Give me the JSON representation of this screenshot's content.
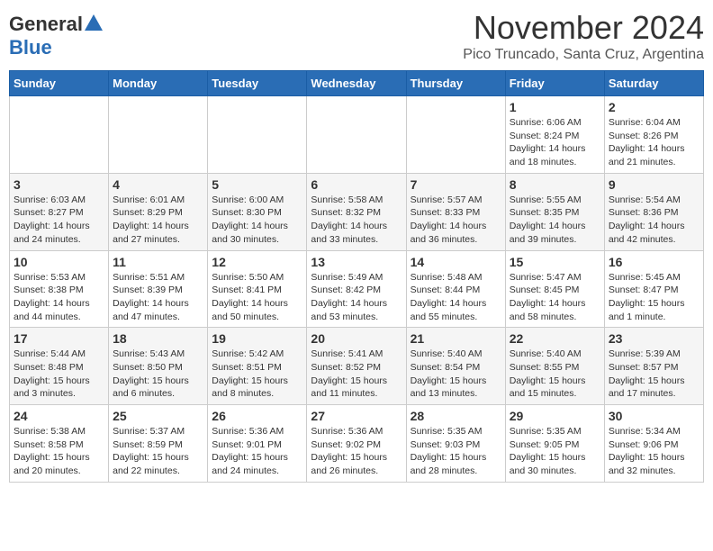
{
  "header": {
    "logo_general": "General",
    "logo_blue": "Blue",
    "month_title": "November 2024",
    "location": "Pico Truncado, Santa Cruz, Argentina"
  },
  "days_of_week": [
    "Sunday",
    "Monday",
    "Tuesday",
    "Wednesday",
    "Thursday",
    "Friday",
    "Saturday"
  ],
  "weeks": [
    [
      {
        "day": "",
        "info": ""
      },
      {
        "day": "",
        "info": ""
      },
      {
        "day": "",
        "info": ""
      },
      {
        "day": "",
        "info": ""
      },
      {
        "day": "",
        "info": ""
      },
      {
        "day": "1",
        "info": "Sunrise: 6:06 AM\nSunset: 8:24 PM\nDaylight: 14 hours and 18 minutes."
      },
      {
        "day": "2",
        "info": "Sunrise: 6:04 AM\nSunset: 8:26 PM\nDaylight: 14 hours and 21 minutes."
      }
    ],
    [
      {
        "day": "3",
        "info": "Sunrise: 6:03 AM\nSunset: 8:27 PM\nDaylight: 14 hours and 24 minutes."
      },
      {
        "day": "4",
        "info": "Sunrise: 6:01 AM\nSunset: 8:29 PM\nDaylight: 14 hours and 27 minutes."
      },
      {
        "day": "5",
        "info": "Sunrise: 6:00 AM\nSunset: 8:30 PM\nDaylight: 14 hours and 30 minutes."
      },
      {
        "day": "6",
        "info": "Sunrise: 5:58 AM\nSunset: 8:32 PM\nDaylight: 14 hours and 33 minutes."
      },
      {
        "day": "7",
        "info": "Sunrise: 5:57 AM\nSunset: 8:33 PM\nDaylight: 14 hours and 36 minutes."
      },
      {
        "day": "8",
        "info": "Sunrise: 5:55 AM\nSunset: 8:35 PM\nDaylight: 14 hours and 39 minutes."
      },
      {
        "day": "9",
        "info": "Sunrise: 5:54 AM\nSunset: 8:36 PM\nDaylight: 14 hours and 42 minutes."
      }
    ],
    [
      {
        "day": "10",
        "info": "Sunrise: 5:53 AM\nSunset: 8:38 PM\nDaylight: 14 hours and 44 minutes."
      },
      {
        "day": "11",
        "info": "Sunrise: 5:51 AM\nSunset: 8:39 PM\nDaylight: 14 hours and 47 minutes."
      },
      {
        "day": "12",
        "info": "Sunrise: 5:50 AM\nSunset: 8:41 PM\nDaylight: 14 hours and 50 minutes."
      },
      {
        "day": "13",
        "info": "Sunrise: 5:49 AM\nSunset: 8:42 PM\nDaylight: 14 hours and 53 minutes."
      },
      {
        "day": "14",
        "info": "Sunrise: 5:48 AM\nSunset: 8:44 PM\nDaylight: 14 hours and 55 minutes."
      },
      {
        "day": "15",
        "info": "Sunrise: 5:47 AM\nSunset: 8:45 PM\nDaylight: 14 hours and 58 minutes."
      },
      {
        "day": "16",
        "info": "Sunrise: 5:45 AM\nSunset: 8:47 PM\nDaylight: 15 hours and 1 minute."
      }
    ],
    [
      {
        "day": "17",
        "info": "Sunrise: 5:44 AM\nSunset: 8:48 PM\nDaylight: 15 hours and 3 minutes."
      },
      {
        "day": "18",
        "info": "Sunrise: 5:43 AM\nSunset: 8:50 PM\nDaylight: 15 hours and 6 minutes."
      },
      {
        "day": "19",
        "info": "Sunrise: 5:42 AM\nSunset: 8:51 PM\nDaylight: 15 hours and 8 minutes."
      },
      {
        "day": "20",
        "info": "Sunrise: 5:41 AM\nSunset: 8:52 PM\nDaylight: 15 hours and 11 minutes."
      },
      {
        "day": "21",
        "info": "Sunrise: 5:40 AM\nSunset: 8:54 PM\nDaylight: 15 hours and 13 minutes."
      },
      {
        "day": "22",
        "info": "Sunrise: 5:40 AM\nSunset: 8:55 PM\nDaylight: 15 hours and 15 minutes."
      },
      {
        "day": "23",
        "info": "Sunrise: 5:39 AM\nSunset: 8:57 PM\nDaylight: 15 hours and 17 minutes."
      }
    ],
    [
      {
        "day": "24",
        "info": "Sunrise: 5:38 AM\nSunset: 8:58 PM\nDaylight: 15 hours and 20 minutes."
      },
      {
        "day": "25",
        "info": "Sunrise: 5:37 AM\nSunset: 8:59 PM\nDaylight: 15 hours and 22 minutes."
      },
      {
        "day": "26",
        "info": "Sunrise: 5:36 AM\nSunset: 9:01 PM\nDaylight: 15 hours and 24 minutes."
      },
      {
        "day": "27",
        "info": "Sunrise: 5:36 AM\nSunset: 9:02 PM\nDaylight: 15 hours and 26 minutes."
      },
      {
        "day": "28",
        "info": "Sunrise: 5:35 AM\nSunset: 9:03 PM\nDaylight: 15 hours and 28 minutes."
      },
      {
        "day": "29",
        "info": "Sunrise: 5:35 AM\nSunset: 9:05 PM\nDaylight: 15 hours and 30 minutes."
      },
      {
        "day": "30",
        "info": "Sunrise: 5:34 AM\nSunset: 9:06 PM\nDaylight: 15 hours and 32 minutes."
      }
    ]
  ]
}
